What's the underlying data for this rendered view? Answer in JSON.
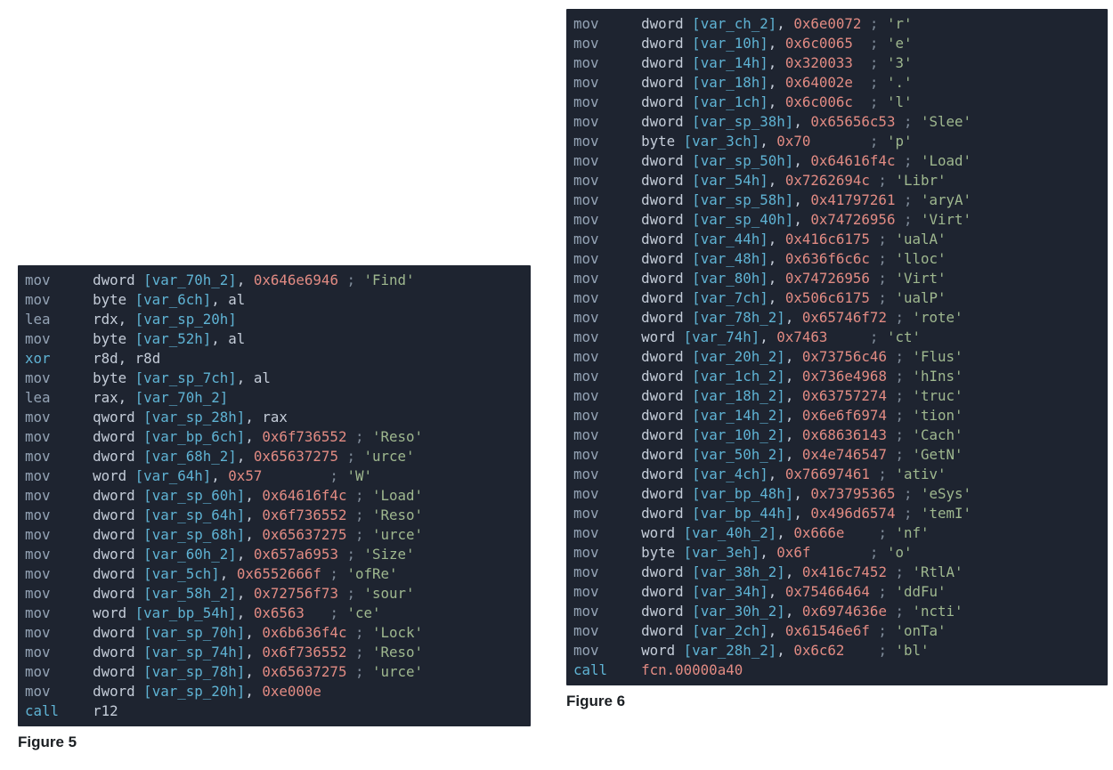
{
  "figures": {
    "left": {
      "caption": "Figure 5",
      "lines": [
        {
          "op": "mov",
          "type": "dword",
          "var": "var_70h_2",
          "hex": "0x646e6946",
          "cm": "'Find'"
        },
        {
          "op": "mov",
          "type": "byte",
          "var": "var_6ch",
          "reg": "al"
        },
        {
          "op": "lea",
          "regdst": "rdx",
          "var": "var_sp_20h"
        },
        {
          "op": "mov",
          "type": "byte",
          "var": "var_52h",
          "reg": "al"
        },
        {
          "op": "xor",
          "left": "r8d",
          "right": "r8d",
          "style": "xor"
        },
        {
          "op": "mov",
          "type": "byte",
          "var": "var_sp_7ch",
          "reg": "al"
        },
        {
          "op": "lea",
          "regdst": "rax",
          "var": "var_70h_2"
        },
        {
          "op": "mov",
          "type": "qword",
          "var": "var_sp_28h",
          "reg": "rax"
        },
        {
          "op": "mov",
          "type": "dword",
          "var": "var_bp_6ch",
          "hex": "0x6f736552",
          "cm": "'Reso'"
        },
        {
          "op": "mov",
          "type": "dword",
          "var": "var_68h_2",
          "hex": "0x65637275",
          "cm": "'urce'"
        },
        {
          "op": "mov",
          "type": "word",
          "var": "var_64h",
          "hex": "0x57",
          "cm": "'W'",
          "pad": "        "
        },
        {
          "op": "mov",
          "type": "dword",
          "var": "var_sp_60h",
          "hex": "0x64616f4c",
          "cm": "'Load'"
        },
        {
          "op": "mov",
          "type": "dword",
          "var": "var_sp_64h",
          "hex": "0x6f736552",
          "cm": "'Reso'"
        },
        {
          "op": "mov",
          "type": "dword",
          "var": "var_sp_68h",
          "hex": "0x65637275",
          "cm": "'urce'"
        },
        {
          "op": "mov",
          "type": "dword",
          "var": "var_60h_2",
          "hex": "0x657a6953",
          "cm": "'Size'"
        },
        {
          "op": "mov",
          "type": "dword",
          "var": "var_5ch",
          "hex": "0x6552666f",
          "cm": "'ofRe'"
        },
        {
          "op": "mov",
          "type": "dword",
          "var": "var_58h_2",
          "hex": "0x72756f73",
          "cm": "'sour'"
        },
        {
          "op": "mov",
          "type": "word",
          "var": "var_bp_54h",
          "hex": "0x6563",
          "cm": "'ce'",
          "pad": "   "
        },
        {
          "op": "mov",
          "type": "dword",
          "var": "var_sp_70h",
          "hex": "0x6b636f4c",
          "cm": "'Lock'"
        },
        {
          "op": "mov",
          "type": "dword",
          "var": "var_sp_74h",
          "hex": "0x6f736552",
          "cm": "'Reso'"
        },
        {
          "op": "mov",
          "type": "dword",
          "var": "var_sp_78h",
          "hex": "0x65637275",
          "cm": "'urce'"
        },
        {
          "op": "mov",
          "type": "dword",
          "var": "var_sp_20h",
          "hex": "0xe000e"
        },
        {
          "op": "call",
          "target": "r12"
        }
      ]
    },
    "right": {
      "caption": "Figure 6",
      "lines": [
        {
          "op": "mov",
          "type": "dword",
          "var": "var_ch_2",
          "hex": "0x6e0072",
          "cm": "'r'"
        },
        {
          "op": "mov",
          "type": "dword",
          "var": "var_10h",
          "hex": "0x6c0065",
          "cm": "'e'",
          "pad": "  "
        },
        {
          "op": "mov",
          "type": "dword",
          "var": "var_14h",
          "hex": "0x320033",
          "cm": "'3'",
          "pad": "  "
        },
        {
          "op": "mov",
          "type": "dword",
          "var": "var_18h",
          "hex": "0x64002e",
          "cm": "'.'",
          "pad": "  "
        },
        {
          "op": "mov",
          "type": "dword",
          "var": "var_1ch",
          "hex": "0x6c006c",
          "cm": "'l'",
          "pad": "  "
        },
        {
          "op": "mov",
          "type": "dword",
          "var": "var_sp_38h",
          "hex": "0x65656c53",
          "cm": "'Slee'"
        },
        {
          "op": "mov",
          "type": "byte",
          "var": "var_3ch",
          "hex": "0x70",
          "cm": "'p'",
          "pad": "       "
        },
        {
          "op": "mov",
          "type": "dword",
          "var": "var_sp_50h",
          "hex": "0x64616f4c",
          "cm": "'Load'"
        },
        {
          "op": "mov",
          "type": "dword",
          "var": "var_54h",
          "hex": "0x7262694c",
          "cm": "'Libr'"
        },
        {
          "op": "mov",
          "type": "dword",
          "var": "var_sp_58h",
          "hex": "0x41797261",
          "cm": "'aryA'"
        },
        {
          "op": "mov",
          "type": "dword",
          "var": "var_sp_40h",
          "hex": "0x74726956",
          "cm": "'Virt'"
        },
        {
          "op": "mov",
          "type": "dword",
          "var": "var_44h",
          "hex": "0x416c6175",
          "cm": "'ualA'"
        },
        {
          "op": "mov",
          "type": "dword",
          "var": "var_48h",
          "hex": "0x636f6c6c",
          "cm": "'lloc'"
        },
        {
          "op": "mov",
          "type": "dword",
          "var": "var_80h",
          "hex": "0x74726956",
          "cm": "'Virt'"
        },
        {
          "op": "mov",
          "type": "dword",
          "var": "var_7ch",
          "hex": "0x506c6175",
          "cm": "'ualP'"
        },
        {
          "op": "mov",
          "type": "dword",
          "var": "var_78h_2",
          "hex": "0x65746f72",
          "cm": "'rote'"
        },
        {
          "op": "mov",
          "type": "word",
          "var": "var_74h",
          "hex": "0x7463",
          "cm": "'ct'",
          "pad": "     "
        },
        {
          "op": "mov",
          "type": "dword",
          "var": "var_20h_2",
          "hex": "0x73756c46",
          "cm": "'Flus'"
        },
        {
          "op": "mov",
          "type": "dword",
          "var": "var_1ch_2",
          "hex": "0x736e4968",
          "cm": "'hIns'"
        },
        {
          "op": "mov",
          "type": "dword",
          "var": "var_18h_2",
          "hex": "0x63757274",
          "cm": "'truc'"
        },
        {
          "op": "mov",
          "type": "dword",
          "var": "var_14h_2",
          "hex": "0x6e6f6974",
          "cm": "'tion'"
        },
        {
          "op": "mov",
          "type": "dword",
          "var": "var_10h_2",
          "hex": "0x68636143",
          "cm": "'Cach'"
        },
        {
          "op": "mov",
          "type": "dword",
          "var": "var_50h_2",
          "hex": "0x4e746547",
          "cm": "'GetN'"
        },
        {
          "op": "mov",
          "type": "dword",
          "var": "var_4ch",
          "hex": "0x76697461",
          "cm": "'ativ'"
        },
        {
          "op": "mov",
          "type": "dword",
          "var": "var_bp_48h",
          "hex": "0x73795365",
          "cm": "'eSys'"
        },
        {
          "op": "mov",
          "type": "dword",
          "var": "var_bp_44h",
          "hex": "0x496d6574",
          "cm": "'temI'"
        },
        {
          "op": "mov",
          "type": "word",
          "var": "var_40h_2",
          "hex": "0x666e",
          "cm": "'nf'",
          "pad": "    "
        },
        {
          "op": "mov",
          "type": "byte",
          "var": "var_3eh",
          "hex": "0x6f",
          "cm": "'o'",
          "pad": "       "
        },
        {
          "op": "mov",
          "type": "dword",
          "var": "var_38h_2",
          "hex": "0x416c7452",
          "cm": "'RtlA'"
        },
        {
          "op": "mov",
          "type": "dword",
          "var": "var_34h",
          "hex": "0x75466464",
          "cm": "'ddFu'"
        },
        {
          "op": "mov",
          "type": "dword",
          "var": "var_30h_2",
          "hex": "0x6974636e",
          "cm": "'ncti'"
        },
        {
          "op": "mov",
          "type": "dword",
          "var": "var_2ch",
          "hex": "0x61546e6f",
          "cm": "'onTa'"
        },
        {
          "op": "mov",
          "type": "word",
          "var": "var_28h_2",
          "hex": "0x6c62",
          "cm": "'bl'",
          "pad": "    "
        },
        {
          "op": "call",
          "target": "fcn.00000a40",
          "targetStyle": "fn"
        }
      ]
    }
  }
}
